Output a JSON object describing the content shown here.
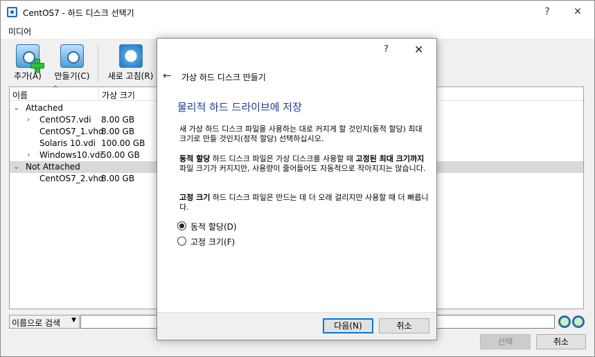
{
  "window": {
    "title": "CentOS7 - 하드 디스크 선택기",
    "help": "?",
    "close": "✕"
  },
  "menubar": {
    "media": "미디어"
  },
  "toolbar": {
    "add": "추가(A)",
    "create": "만들기(C)",
    "refresh": "새로 고침(R)"
  },
  "list": {
    "col_name": "이름",
    "col_size": "가상 크기",
    "sort_caret": "^",
    "attached_label": "Attached",
    "not_attached_label": "Not Attached",
    "attached": [
      {
        "name": "CentOS7.vdi",
        "size": "8.00 GB",
        "expandable": true
      },
      {
        "name": "CentOS7_1.vhd",
        "size": "8.00 GB",
        "expandable": false
      },
      {
        "name": "Solaris 10.vdi",
        "size": "100.00 GB",
        "expandable": false
      },
      {
        "name": "Windows10.vdi",
        "size": "50.00 GB",
        "expandable": true
      }
    ],
    "not_attached": [
      {
        "name": "CentOS7_2.vhd",
        "size": "8.00 GB",
        "expandable": false
      }
    ]
  },
  "search": {
    "mode": "이름으로 검색",
    "value": ""
  },
  "footer": {
    "choose": "선택",
    "cancel": "취소"
  },
  "dialog": {
    "help": "?",
    "close": "✕",
    "back": "←",
    "wizard_title": "가상 하드 디스크 만들기",
    "page_title": "물리적 하드 드라이브에 저장",
    "intro": "새 가상 하드 디스크 파일을 사용하는 대로 커지게 할 것인지(동적 할당) 최대 크기로 만들 것인지(정적 할당) 선택하십시오.",
    "dynamic_term": "동적 할당",
    "dynamic_mid": " 하드 디스크 파일은 가상 디스크를 사용할 때 ",
    "dynamic_term2": "고정된 최대 크기까지",
    "dynamic_rest": " 파일 크기가 커지지만, 사용량이 줄어들어도 자동적으로 작아지지는 않습니다.",
    "fixed_term": "고정 크기",
    "fixed_rest": " 하드 디스크 파일은 만드는 데 더 오래 걸리지만 사용할 때 더 빠릅니다.",
    "option_dynamic": "동적 할당(D)",
    "option_fixed": "고정 크기(F)",
    "selected_option": "dynamic",
    "next": "다음(N)",
    "cancel": "취소"
  }
}
